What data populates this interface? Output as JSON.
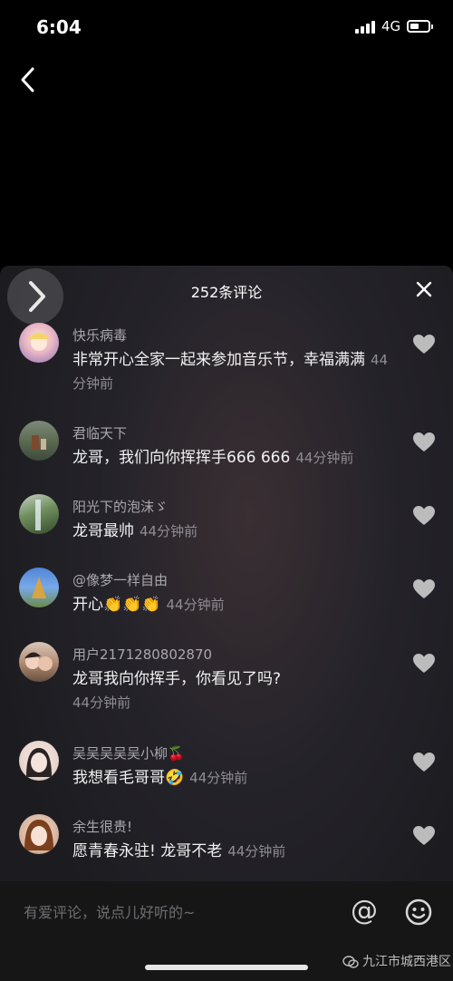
{
  "status": {
    "time": "6:04",
    "network": "4G",
    "battery_level": 0.5
  },
  "panel": {
    "title": "252条评论"
  },
  "comments": [
    {
      "username": "快乐病毒",
      "text": "非常开心全家一起来参加音乐节，幸福满满",
      "time": "44分钟前"
    },
    {
      "username": "君临天下",
      "text": "龙哥，我们向你挥挥手666 666",
      "time": "44分钟前"
    },
    {
      "username": "阳光下的泡沫ゞ",
      "text": "龙哥最帅",
      "time": "44分钟前"
    },
    {
      "username": "@像梦一样自由",
      "text": "开心👏👏👏",
      "time": "44分钟前"
    },
    {
      "username": "用户2171280802870",
      "text": "龙哥我向你挥手，你看见了吗?",
      "time": "44分钟前"
    },
    {
      "username": "吴吴吴吴吴小柳🍒",
      "text": "我想看毛哥哥🤣",
      "time": "44分钟前"
    },
    {
      "username": "余生很贵!",
      "text": "愿青春永驻! 龙哥不老",
      "time": "44分钟前"
    }
  ],
  "input": {
    "placeholder": "有爱评论，说点儿好听的~",
    "at_label": "@"
  },
  "watermark": {
    "text": "九江市城西港区"
  },
  "icons": {
    "back": "chevron-left-icon",
    "close": "close-icon",
    "like": "heart-icon",
    "emoji": "smiley-icon",
    "side": "chevron-right-icon",
    "wechat": "wechat-icon"
  },
  "colors": {
    "background": "#000000",
    "panel": "#1c1c20",
    "username": "#a9a7ad",
    "time": "#8f8d93",
    "heart": "#bcbcbc"
  }
}
